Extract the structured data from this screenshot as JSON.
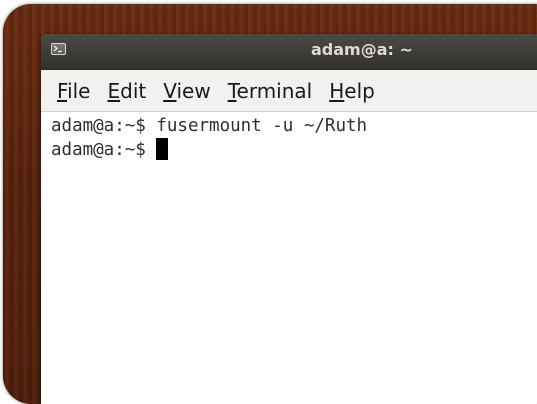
{
  "window": {
    "title": "adam@a: ~"
  },
  "menu": {
    "items": [
      {
        "mnemonic": "F",
        "rest": "ile"
      },
      {
        "mnemonic": "E",
        "rest": "dit"
      },
      {
        "mnemonic": "V",
        "rest": "iew"
      },
      {
        "mnemonic": "T",
        "rest": "erminal"
      },
      {
        "mnemonic": "H",
        "rest": "elp"
      }
    ]
  },
  "terminal": {
    "lines": [
      "adam@a:~$ fusermount -u ~/Ruth",
      "adam@a:~$ "
    ]
  },
  "icons": {
    "title_icon": "terminal-icon"
  },
  "colors": {
    "desktop_frame": "#5b230d",
    "titlebar": "#3d3c38",
    "title_text": "#dfdbd2",
    "menubar": "#f2f1f0",
    "terminal_bg": "#ffffff",
    "terminal_text": "#2e2e2e"
  }
}
